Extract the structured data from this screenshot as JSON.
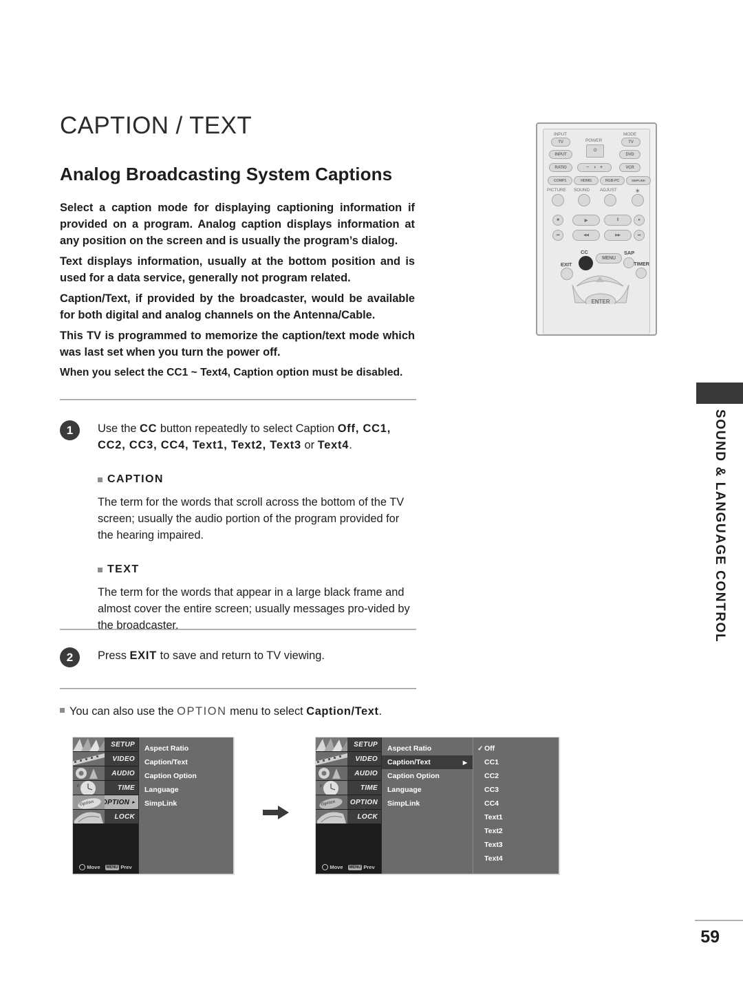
{
  "page": {
    "title": "CAPTION / TEXT",
    "section_title": "Analog Broadcasting System Captions",
    "number": "59",
    "side_tab": "SOUND & LANGUAGE CONTROL"
  },
  "intro": {
    "p1": "Select a caption mode for displaying captioning information if provided on a program. Analog caption displays information at any position on the screen and is usually the program’s dialog.",
    "p2": "Text displays information, usually at the bottom position and is used for a data service, generally not program related.",
    "p3": "Caption/Text, if provided by the broadcaster, would be available for both digital and analog channels on the Antenna/Cable.",
    "p4": "This TV is programmed to memorize the caption/text mode which was last set when you turn the power off.",
    "p5": "When you select the CC1 ~ Text4, Caption option must be disabled."
  },
  "steps": {
    "one": {
      "number": "1",
      "text_lead": "Use the ",
      "cc_label": "CC",
      "text_mid": " button repeatedly to select Caption ",
      "options": "Off, CC1, CC2, CC3, CC4, Text1, Text2, Text3",
      "text_or": " or ",
      "option_last": "Text4",
      "text_end": ".",
      "caption_heading": "CAPTION",
      "caption_body": "The term for the words that scroll across the bottom of the TV screen; usually the audio portion of the program provided for the hearing impaired.",
      "text_heading": "TEXT",
      "text_body": "The term for the words that appear in a large black frame and almost cover the entire screen; usually messages pro-vided by the broadcaster."
    },
    "two": {
      "number": "2",
      "text_lead": "Press ",
      "exit_label": "EXIT",
      "text_end": " to save and return to TV viewing."
    }
  },
  "note": {
    "lead": "You can also use the ",
    "option_label": "OPTION",
    "mid": " menu to select ",
    "target_label": "Caption/Text",
    "end": "."
  },
  "osd": {
    "sidebar": [
      {
        "label": "SETUP",
        "active": false
      },
      {
        "label": "VIDEO",
        "active": false
      },
      {
        "label": "AUDIO",
        "active": false
      },
      {
        "label": "TIME",
        "active": false
      },
      {
        "label": "OPTION",
        "active": true
      },
      {
        "label": "LOCK",
        "active": false
      }
    ],
    "sidebar_plain": [
      {
        "label": "SETUP",
        "active": false
      },
      {
        "label": "VIDEO",
        "active": false
      },
      {
        "label": "AUDIO",
        "active": false
      },
      {
        "label": "TIME",
        "active": false
      },
      {
        "label": "OPTION",
        "active": false
      },
      {
        "label": "LOCK",
        "active": false
      }
    ],
    "menu_items": [
      {
        "label": "Aspect Ratio",
        "selected": false
      },
      {
        "label": "Caption/Text",
        "selected": false
      },
      {
        "label": "Caption Option",
        "selected": false
      },
      {
        "label": "Language",
        "selected": false
      },
      {
        "label": "SimpLink",
        "selected": false
      }
    ],
    "menu_items_2": [
      {
        "label": "Aspect Ratio",
        "selected": false
      },
      {
        "label": "Caption/Text",
        "selected": true
      },
      {
        "label": "Caption Option",
        "selected": false
      },
      {
        "label": "Language",
        "selected": false
      },
      {
        "label": "SimpLink",
        "selected": false
      }
    ],
    "submenu": [
      {
        "label": "Off",
        "checked": true
      },
      {
        "label": "CC1",
        "checked": false
      },
      {
        "label": "CC2",
        "checked": false
      },
      {
        "label": "CC3",
        "checked": false
      },
      {
        "label": "CC4",
        "checked": false
      },
      {
        "label": "Text1",
        "checked": false
      },
      {
        "label": "Text2",
        "checked": false
      },
      {
        "label": "Text3",
        "checked": false
      },
      {
        "label": "Text4",
        "checked": false
      }
    ],
    "footer": {
      "move_label": "Move",
      "prev_key": "MENU",
      "prev_label": "Prev"
    },
    "arrow_icon": "right-arrow"
  },
  "remote": {
    "labels": {
      "input": "INPUT",
      "mode": "MODE",
      "power": "POWER",
      "picture": "PICTURE",
      "sound": "SOUND",
      "adjust": "ADJUST",
      "star": "∗",
      "cc": "CC",
      "exit": "EXIT",
      "sap": "SAP",
      "timer": "TIMER",
      "enter": "ENTER"
    },
    "buttons": {
      "tv_input": "TV",
      "tv_mode": "TV",
      "input": "INPUT",
      "dvd": "DVD",
      "ratio": "RATIO",
      "vcr": "VCR",
      "comp1": "COMP1",
      "hdmi1": "HDMI1",
      "rgb_pc": "RGB-PC",
      "simplink": "SIMPLINK",
      "menu": "MENU",
      "brightness_minus": "−",
      "brightness_plus": "+",
      "brightness_icon": "◑",
      "power_icon": "⏻",
      "stop": "■",
      "play": "▶",
      "pause": "‖",
      "record": "●",
      "skip_back": "⏮",
      "rewind": "◀◀",
      "forward": "▶▶",
      "skip_forward": "⏭"
    }
  }
}
